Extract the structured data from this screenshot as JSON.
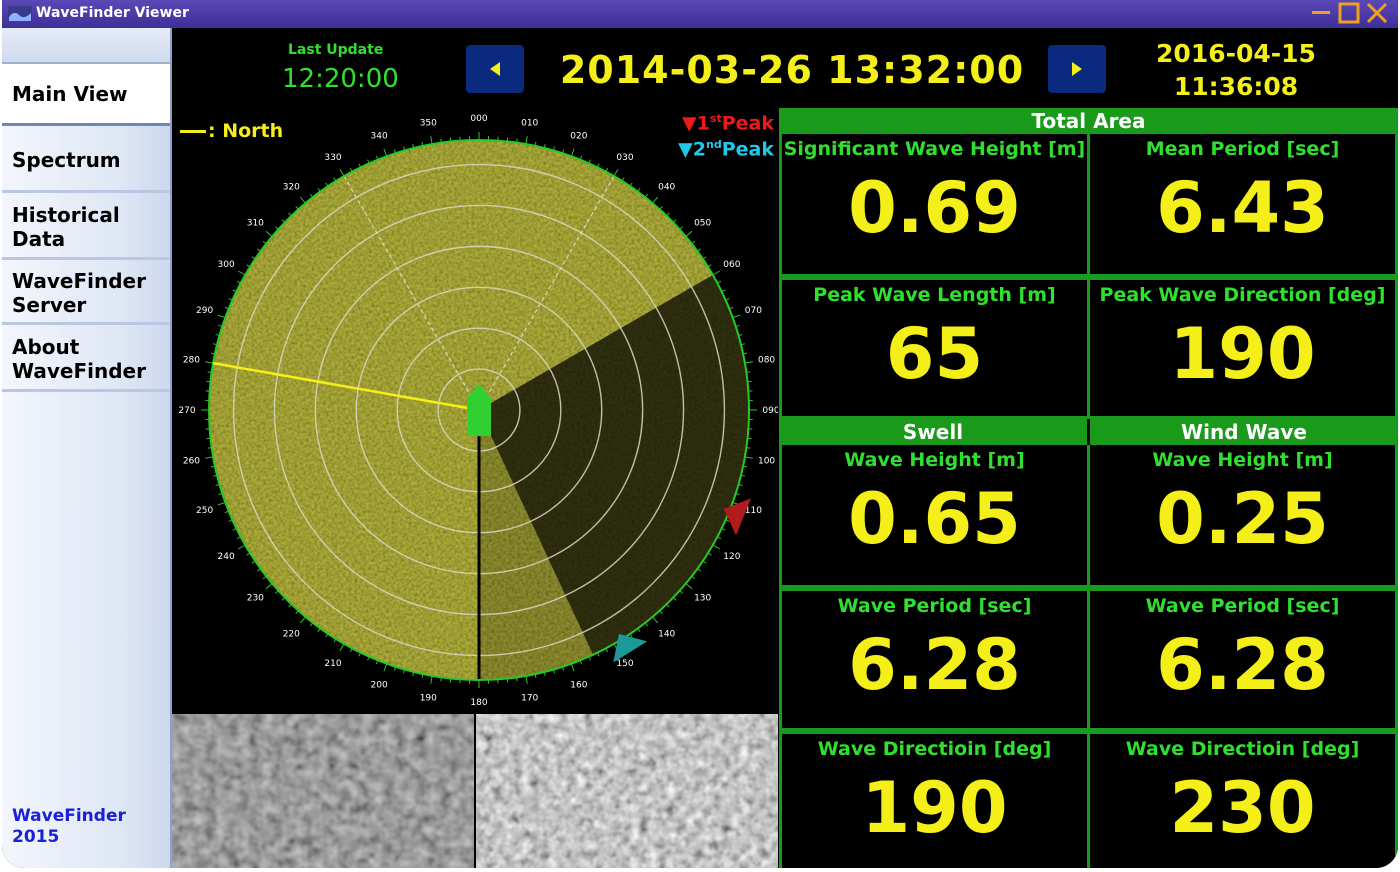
{
  "window": {
    "title": "WaveFinder Viewer"
  },
  "sidebar": {
    "items": [
      {
        "label": "Main View"
      },
      {
        "label": "Spectrum"
      },
      {
        "label": "Historical\nData"
      },
      {
        "label": "WaveFinder\nServer"
      },
      {
        "label": "About\nWaveFinder"
      }
    ],
    "active_item": "Main View",
    "footer": "WaveFinder\n2015"
  },
  "header": {
    "last_update_label": "Last Update",
    "last_update_time": "12:20:00",
    "current_datetime": "2014-03-26 13:32:00",
    "end_datetime": "2016-04-15\n11:36:08"
  },
  "radar": {
    "north_legend": ": North",
    "peak1_legend": {
      "prefix": "1",
      "sup": "st",
      "suffix": "Peak"
    },
    "peak2_legend": {
      "prefix": "2",
      "sup": "nd",
      "suffix": "Peak"
    },
    "bearing_labels": [
      "000",
      "010",
      "020",
      "030",
      "040",
      "050",
      "060",
      "070",
      "080",
      "090",
      "100",
      "110",
      "120",
      "130",
      "140",
      "150",
      "160",
      "170",
      "180",
      "190",
      "200",
      "210",
      "220",
      "230",
      "240",
      "250",
      "260",
      "270",
      "280",
      "290",
      "300",
      "310",
      "320",
      "330",
      "340",
      "350"
    ],
    "north_direction_deg": 280,
    "peak1_direction_deg": 112,
    "peak2_direction_deg": 148,
    "colors": {
      "sea": "#8c8a14",
      "ring": "#d8d8c8",
      "rim": "#28c828",
      "north_line": "#f4ef18",
      "peak1": "#b01c1c",
      "peak2": "#1c9a9a",
      "vessel": "#30d030"
    }
  },
  "total_area": {
    "title": "Total Area",
    "significant_wave_height": {
      "label": "Significant Wave Height [m]",
      "value": "0.69"
    },
    "mean_period": {
      "label": "Mean Period [sec]",
      "value": "6.43"
    },
    "peak_wave_length": {
      "label": "Peak Wave Length [m]",
      "value": "65"
    },
    "peak_wave_direction": {
      "label": "Peak Wave Direction [deg]",
      "value": "190"
    }
  },
  "swell": {
    "title": "Swell",
    "wave_height": {
      "label": "Wave Height [m]",
      "value": "0.65"
    },
    "wave_period": {
      "label": "Wave Period [sec]",
      "value": "6.28"
    },
    "wave_direction": {
      "label": "Wave Directioin [deg]",
      "value": "190"
    }
  },
  "wind_wave": {
    "title": "Wind Wave",
    "wave_height": {
      "label": "Wave Height [m]",
      "value": "0.25"
    },
    "wave_period": {
      "label": "Wave Period [sec]",
      "value": "6.28"
    },
    "wave_direction": {
      "label": "Wave Directioin [deg]",
      "value": "230"
    }
  }
}
